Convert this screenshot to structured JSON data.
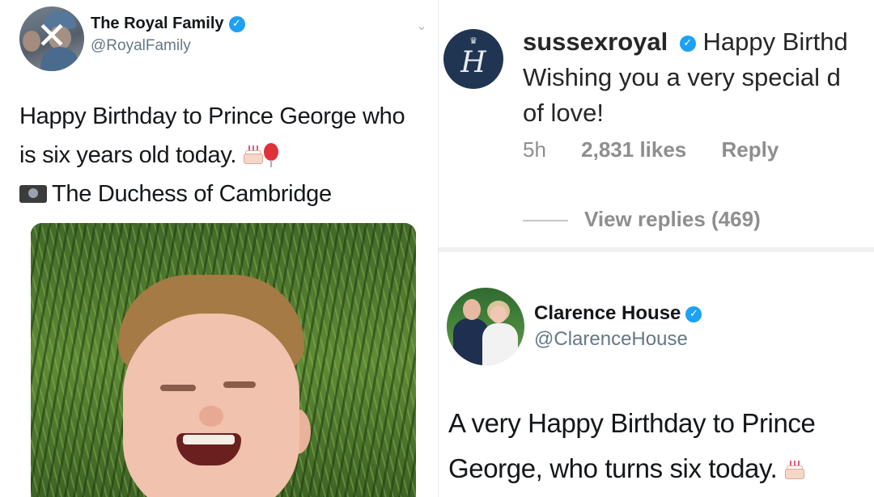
{
  "royal_family_tweet": {
    "name": "The Royal Family",
    "handle": "@RoyalFamily",
    "text_line1": "Happy Birthday to Prince George who",
    "text_line2": "is six years old today.",
    "photo_credit": "The Duchess of Cambridge",
    "icons": [
      "verified-badge",
      "cake-emoji",
      "balloon-emoji",
      "camera-emoji",
      "chevron-down"
    ]
  },
  "sussexroyal_comment": {
    "username": "sussexroyal",
    "text_line1_rest": "Happy Birthd",
    "text_line2": "Wishing you a very special d",
    "text_line3": "of love!",
    "time": "5h",
    "likes": "2,831 likes",
    "reply_label": "Reply",
    "view_replies": "View replies (469)"
  },
  "clarence_house_tweet": {
    "name": "Clarence House",
    "handle": "@ClarenceHouse",
    "text_line1": "A very Happy Birthday to Prince",
    "text_line2": "George, who turns six today."
  }
}
